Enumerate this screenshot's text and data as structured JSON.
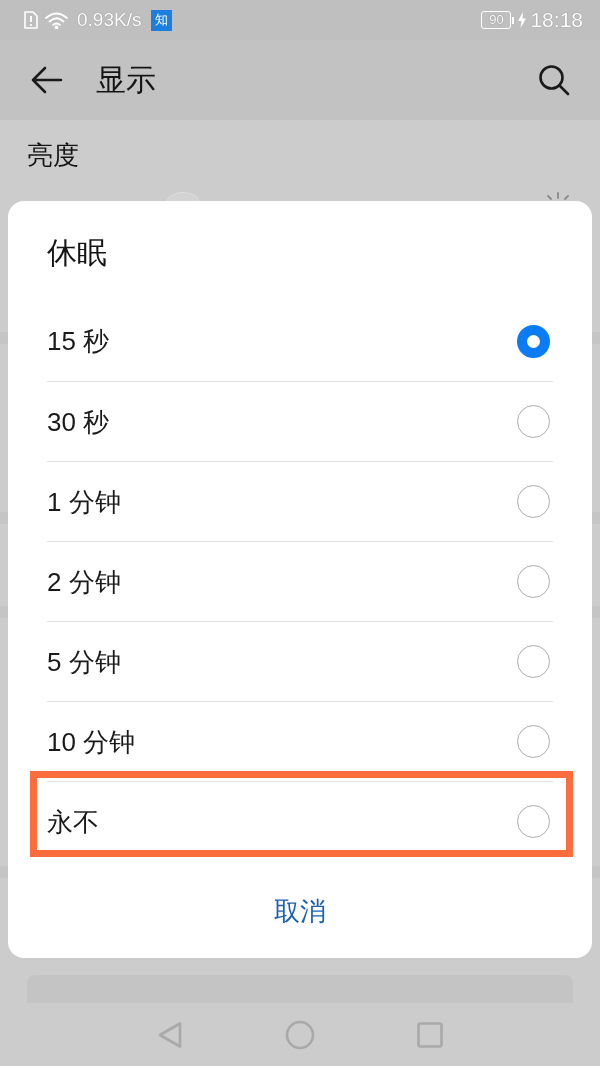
{
  "status_bar": {
    "network_speed": "0.93K/s",
    "notification_badge": "知",
    "battery_percent": "90",
    "time": "18:18"
  },
  "header": {
    "title": "显示"
  },
  "settings": {
    "section_title": "亮度"
  },
  "dialog": {
    "title": "休眠",
    "options": [
      {
        "label": "15 秒",
        "selected": true,
        "highlighted": false
      },
      {
        "label": "30 秒",
        "selected": false,
        "highlighted": false
      },
      {
        "label": "1 分钟",
        "selected": false,
        "highlighted": false
      },
      {
        "label": "2 分钟",
        "selected": false,
        "highlighted": false
      },
      {
        "label": "5 分钟",
        "selected": false,
        "highlighted": false
      },
      {
        "label": "10 分钟",
        "selected": false,
        "highlighted": false
      },
      {
        "label": "永不",
        "selected": false,
        "highlighted": true
      }
    ],
    "cancel_button": "取消"
  }
}
